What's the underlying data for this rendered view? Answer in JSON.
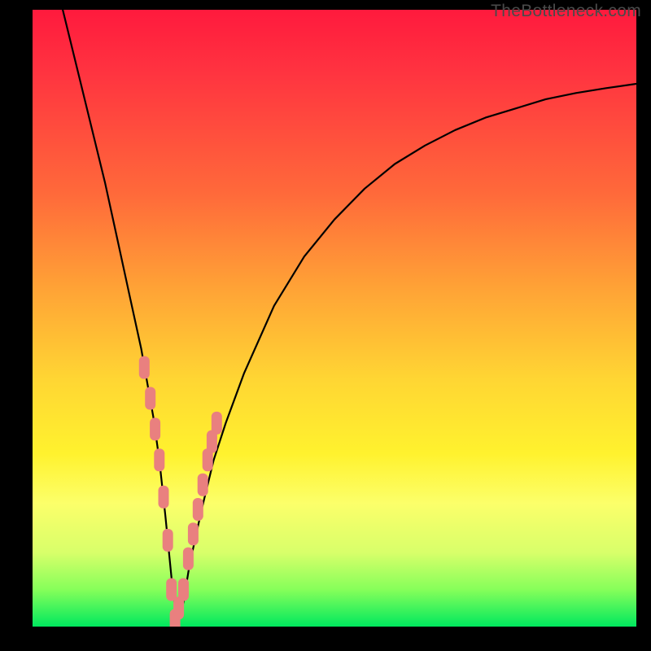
{
  "watermark": "TheBottleneck.com",
  "colors": {
    "background": "#000000",
    "curve": "#000000",
    "marker": "#e9807f",
    "gradient_stops": [
      "#ff1a3d",
      "#ff6a3a",
      "#ffd633",
      "#fcff6a",
      "#00e85e"
    ]
  },
  "chart_data": {
    "type": "line",
    "title": "",
    "xlabel": "",
    "ylabel": "",
    "xlim": [
      0,
      100
    ],
    "ylim": [
      0,
      100
    ],
    "series": [
      {
        "name": "bottleneck-curve",
        "x": [
          5,
          8,
          10,
          12,
          14,
          16,
          18,
          20,
          21,
          22,
          23,
          24,
          25,
          26,
          28,
          30,
          32,
          35,
          40,
          45,
          50,
          55,
          60,
          65,
          70,
          75,
          80,
          85,
          90,
          95,
          100
        ],
        "y": [
          100,
          88,
          80,
          72,
          63,
          54,
          45,
          34,
          27,
          18,
          8,
          0,
          4,
          10,
          19,
          27,
          33,
          41,
          52,
          60,
          66,
          71,
          75,
          78,
          80.5,
          82.5,
          84,
          85.5,
          86.5,
          87.3,
          88
        ]
      }
    ],
    "markers": {
      "name": "highlighted-points",
      "x": [
        18.5,
        19.5,
        20.3,
        21.0,
        21.7,
        22.4,
        23.0,
        23.6,
        24.2,
        25.0,
        25.8,
        26.6,
        27.4,
        28.2,
        29.0,
        29.7,
        30.5
      ],
      "y": [
        42,
        37,
        32,
        27,
        21,
        14,
        6,
        1,
        3,
        6,
        11,
        15,
        19,
        23,
        27,
        30,
        33
      ]
    }
  }
}
